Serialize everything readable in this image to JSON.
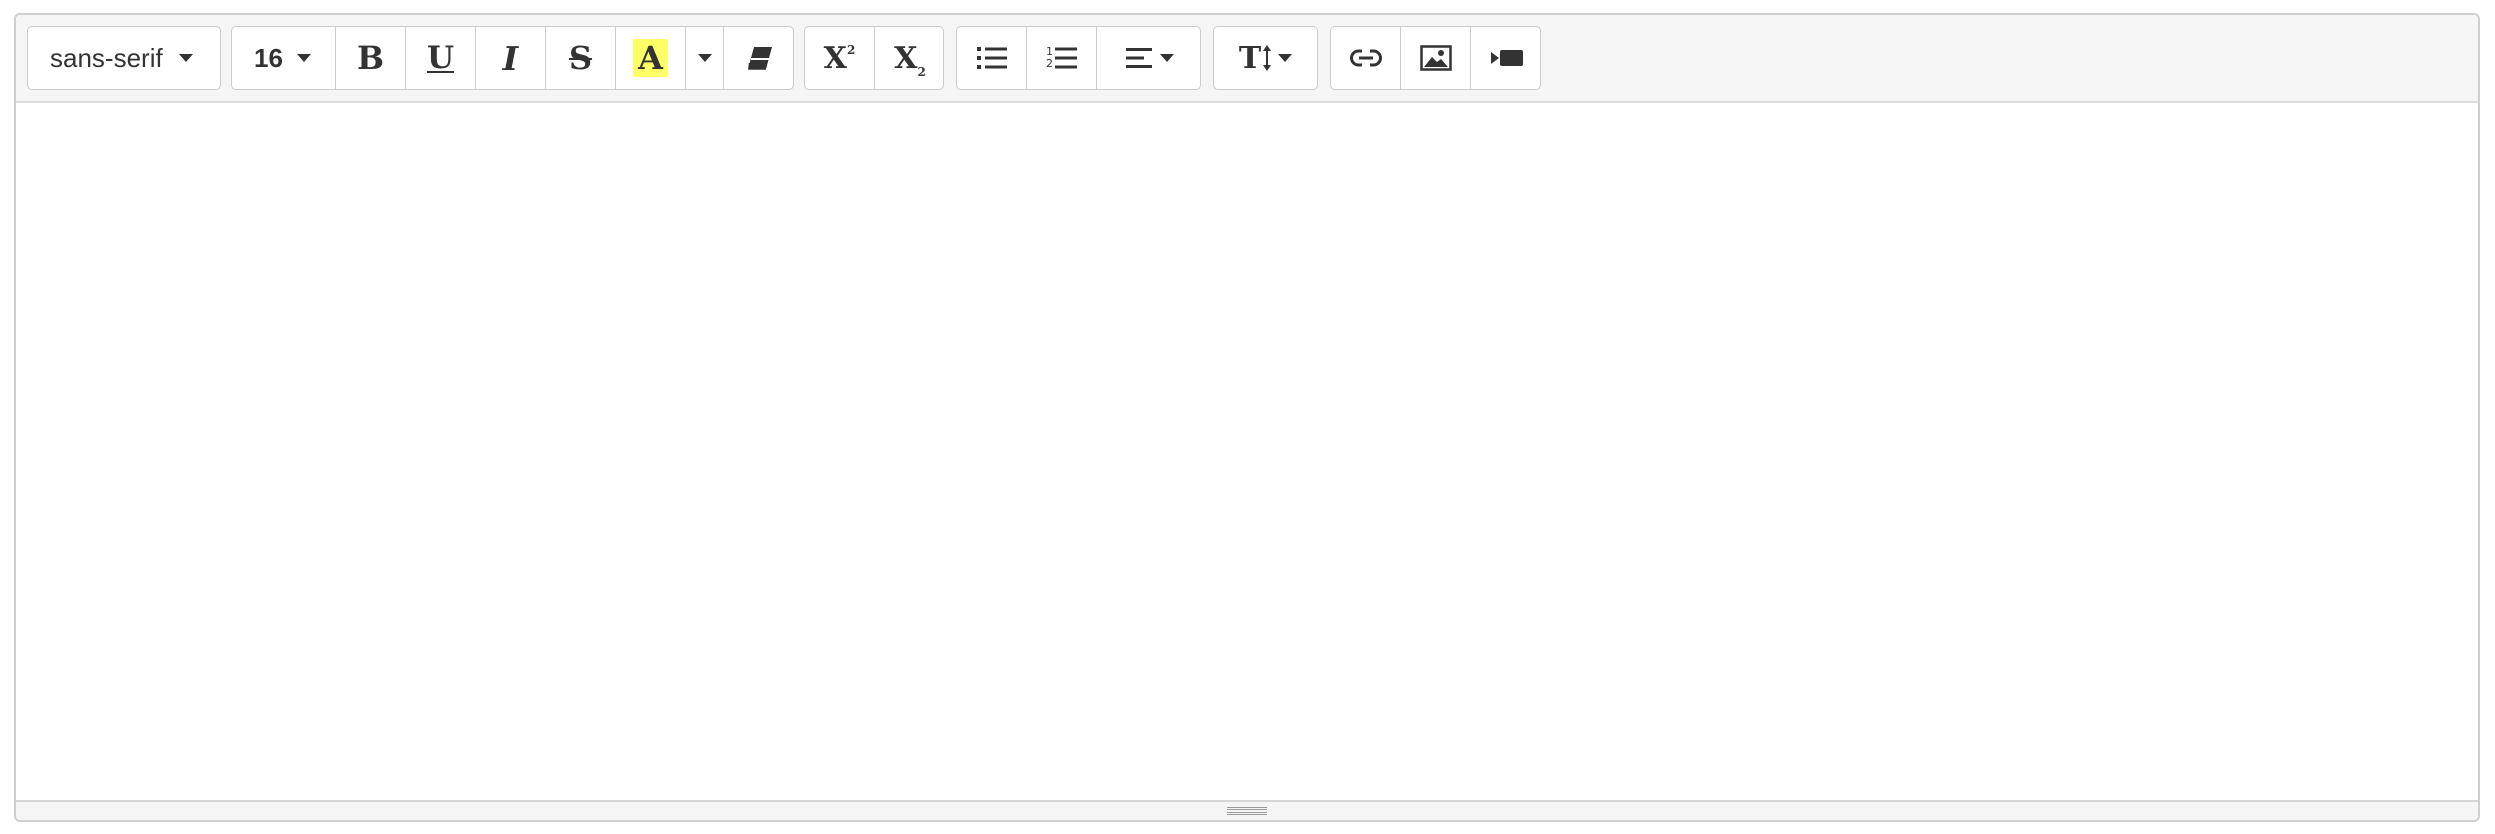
{
  "toolbar": {
    "font_family": {
      "selected": "sans-serif",
      "icon": "chevron-down-icon"
    },
    "font_size": {
      "selected": "16",
      "icon": "chevron-down-icon"
    },
    "style_buttons": [
      {
        "name": "bold",
        "glyph": "B"
      },
      {
        "name": "underline",
        "glyph": "U"
      },
      {
        "name": "italic",
        "glyph": "I"
      },
      {
        "name": "strikethrough",
        "glyph": "S"
      },
      {
        "name": "highlight-color",
        "glyph": "A",
        "highlight": "#ffff66"
      },
      {
        "name": "color-dropdown",
        "icon": "chevron-down-icon"
      },
      {
        "name": "eraser",
        "icon": "eraser-icon"
      }
    ],
    "script_buttons": [
      {
        "name": "superscript",
        "glyph": "X",
        "index": "2"
      },
      {
        "name": "subscript",
        "glyph": "X",
        "index": "2"
      }
    ],
    "paragraph_buttons": [
      {
        "name": "unordered-list",
        "icon": "unordered-list-icon"
      },
      {
        "name": "ordered-list",
        "icon": "ordered-list-icon",
        "numbers": [
          "1",
          "2"
        ]
      },
      {
        "name": "align",
        "icon": "align-left-icon"
      }
    ],
    "height_button": {
      "glyph": "T",
      "icon": "line-height-icon"
    },
    "insert_buttons": [
      {
        "name": "link",
        "icon": "link-icon"
      },
      {
        "name": "image",
        "icon": "image-icon"
      },
      {
        "name": "video",
        "icon": "video-icon"
      }
    ]
  },
  "editor": {
    "content": ""
  },
  "colors": {
    "toolbar_bg": "#f5f5f5",
    "border": "#cccccc",
    "icon": "#333333",
    "highlight": "#ffff66"
  }
}
